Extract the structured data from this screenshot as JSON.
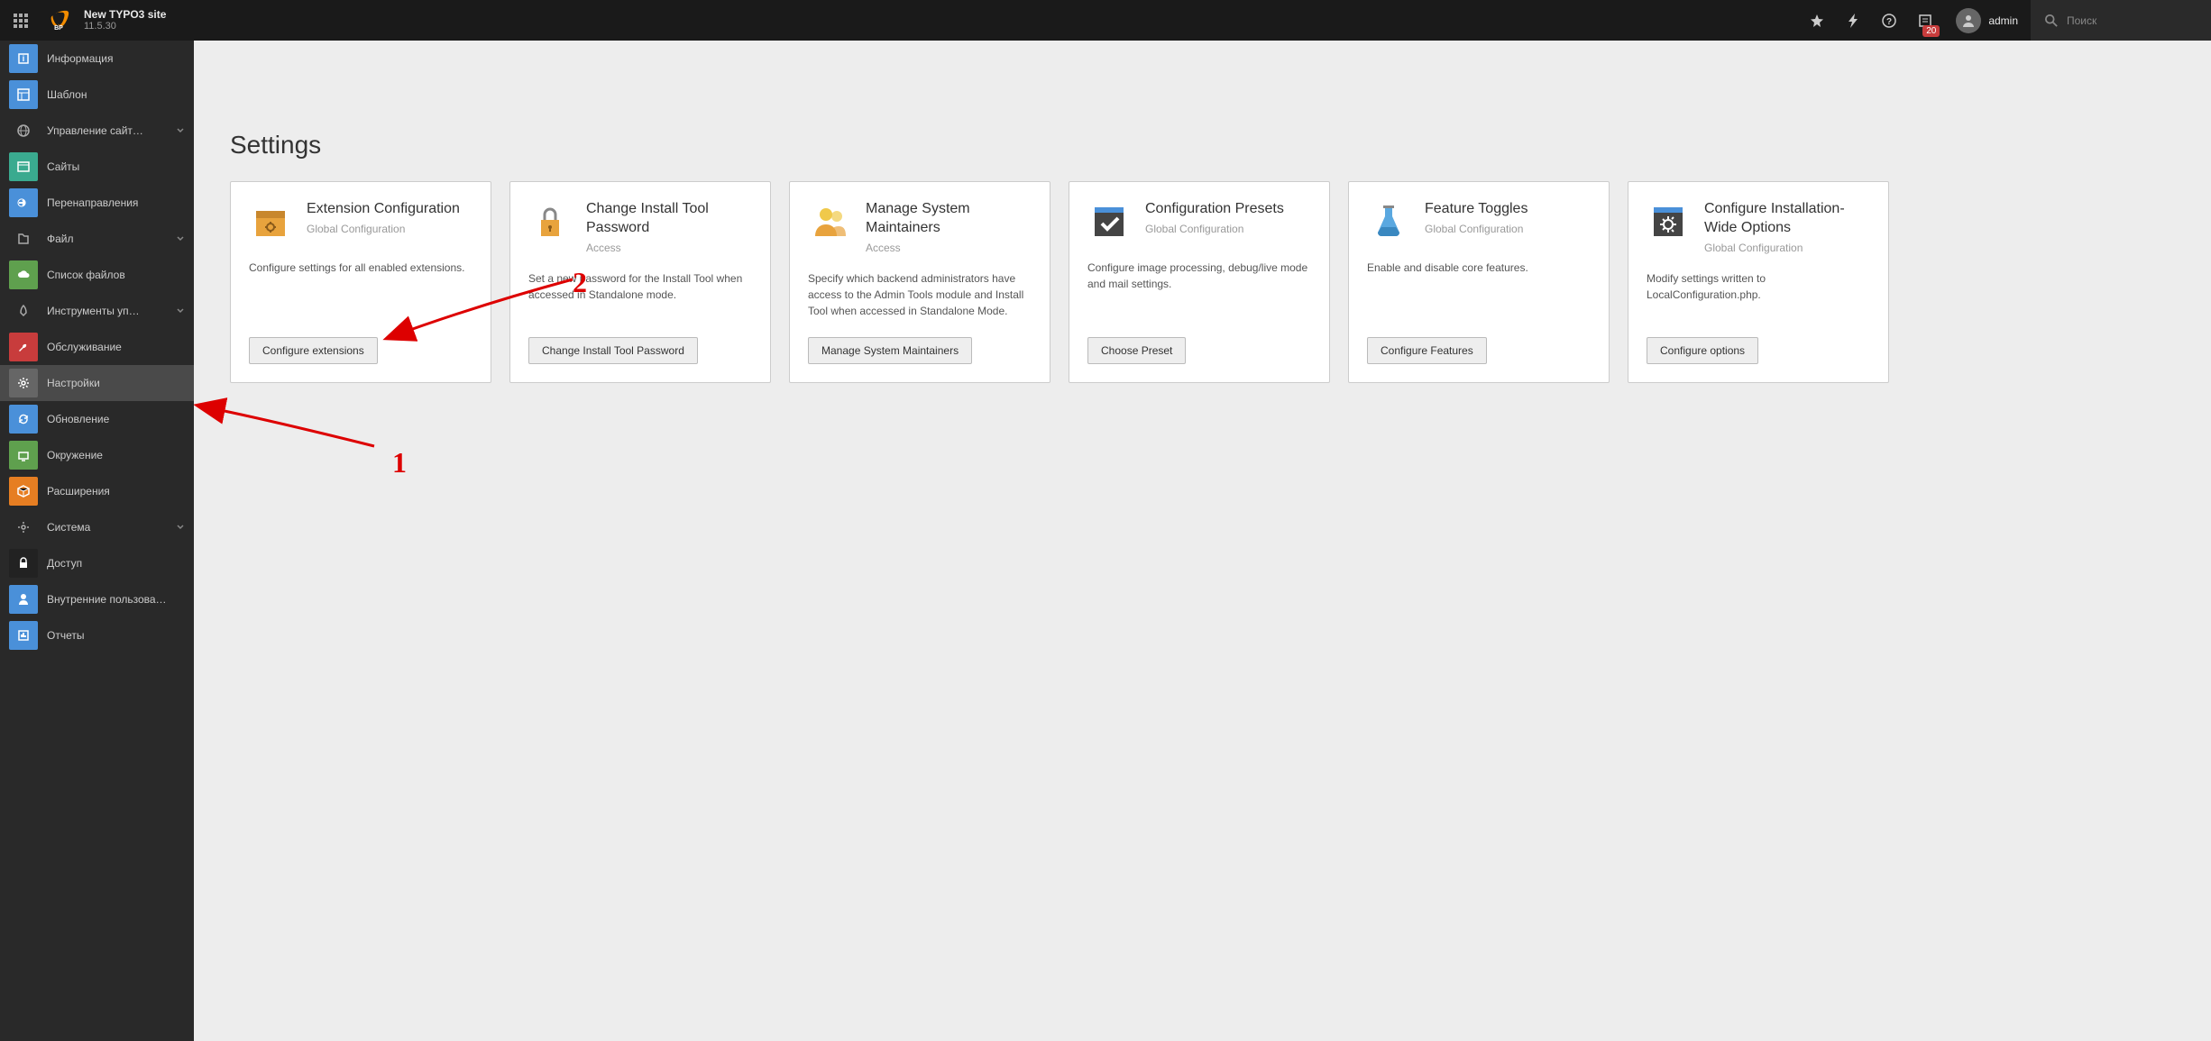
{
  "header": {
    "site_title": "New TYPO3 site",
    "version": "11.5.30",
    "bp_label": "BP",
    "badge_count": "20",
    "username": "admin",
    "search_placeholder": "Поиск"
  },
  "sidebar": {
    "items": [
      {
        "kind": "sub",
        "label": "Информация",
        "icon": "info",
        "bg": "#4a90d9"
      },
      {
        "kind": "sub",
        "label": "Шаблон",
        "icon": "template",
        "bg": "#4a90d9"
      },
      {
        "kind": "group",
        "label": "Управление сайт…",
        "icon": "globe"
      },
      {
        "kind": "sub",
        "label": "Сайты",
        "icon": "sites",
        "bg": "#3aaa8f"
      },
      {
        "kind": "sub",
        "label": "Перенаправления",
        "icon": "redirect",
        "bg": "#4a90d9"
      },
      {
        "kind": "group",
        "label": "Файл",
        "icon": "file-group"
      },
      {
        "kind": "sub",
        "label": "Список файлов",
        "icon": "cloud",
        "bg": "#5fa04e"
      },
      {
        "kind": "group",
        "label": "Инструменты уп…",
        "icon": "rocket"
      },
      {
        "kind": "sub",
        "label": "Обслуживание",
        "icon": "wrench",
        "bg": "#c83c3c"
      },
      {
        "kind": "sub",
        "label": "Настройки",
        "icon": "gear",
        "bg": "#666",
        "active": true
      },
      {
        "kind": "sub",
        "label": "Обновление",
        "icon": "refresh",
        "bg": "#4a90d9"
      },
      {
        "kind": "sub",
        "label": "Окружение",
        "icon": "env",
        "bg": "#5fa04e"
      },
      {
        "kind": "sub",
        "label": "Расширения",
        "icon": "box",
        "bg": "#e67e22"
      },
      {
        "kind": "group",
        "label": "Система",
        "icon": "gear-group"
      },
      {
        "kind": "sub",
        "label": "Доступ",
        "icon": "lock",
        "bg": "#222"
      },
      {
        "kind": "sub",
        "label": "Внутренние пользова…",
        "icon": "user",
        "bg": "#4a90d9"
      },
      {
        "kind": "sub",
        "label": "Отчеты",
        "icon": "reports",
        "bg": "#4a90d9"
      }
    ]
  },
  "page": {
    "title": "Settings",
    "cards": [
      {
        "title": "Extension Configuration",
        "sub": "Global Configuration",
        "desc": "Configure settings for all enabled extensions.",
        "button": "Configure extensions",
        "icon": "ext-box"
      },
      {
        "title": "Change Install Tool Password",
        "sub": "Access",
        "desc": "Set a new password for the Install Tool when accessed in Standalone mode.",
        "button": "Change Install Tool Password",
        "icon": "padlock"
      },
      {
        "title": "Manage System Maintainers",
        "sub": "Access",
        "desc": "Specify which backend administrators have access to the Admin Tools module and Install Tool when accessed in Standalone Mode.",
        "button": "Manage System Maintainers",
        "icon": "people"
      },
      {
        "title": "Configuration Presets",
        "sub": "Global Configuration",
        "desc": "Configure image processing, debug/live mode and mail settings.",
        "button": "Choose Preset",
        "icon": "check"
      },
      {
        "title": "Feature Toggles",
        "sub": "Global Configuration",
        "desc": "Enable and disable core features.",
        "button": "Configure Features",
        "icon": "flask"
      },
      {
        "title": "Configure Installation-Wide Options",
        "sub": "Global Configuration",
        "desc": "Modify settings written to LocalConfiguration.php.",
        "button": "Configure options",
        "icon": "gear-card"
      }
    ]
  },
  "annotations": {
    "one": "1",
    "two": "2"
  }
}
